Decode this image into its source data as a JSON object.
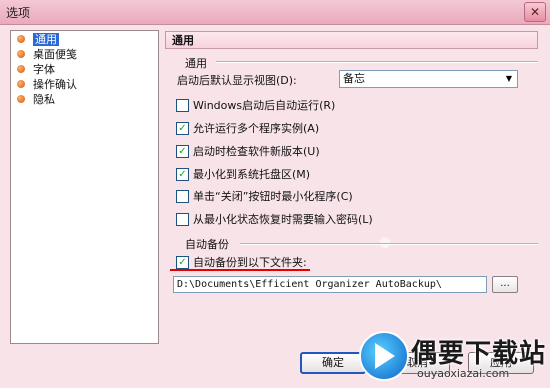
{
  "window": {
    "title": "选项",
    "close_glyph": "✕"
  },
  "tree": {
    "items": [
      {
        "label": "通用",
        "selected": true
      },
      {
        "label": "桌面便笺",
        "selected": false
      },
      {
        "label": "字体",
        "selected": false
      },
      {
        "label": "操作确认",
        "selected": false
      },
      {
        "label": "隐私",
        "selected": false
      }
    ]
  },
  "panel": {
    "header": "通用",
    "general_section": "通用",
    "startup_view_label": "启动后默认显示视图(D):",
    "startup_view_value": "备忘",
    "checkboxes": [
      {
        "label": "Windows启动后自动运行(R)",
        "checked": false
      },
      {
        "label": "允许运行多个程序实例(A)",
        "checked": true
      },
      {
        "label": "启动时检查软件新版本(U)",
        "checked": true
      },
      {
        "label": "最小化到系统托盘区(M)",
        "checked": true
      },
      {
        "label": "单击“关闭”按钮时最小化程序(C)",
        "checked": false
      },
      {
        "label": "从最小化状态恢复时需要输入密码(L)",
        "checked": false
      }
    ],
    "backup_section": "自动备份",
    "backup_checkbox": {
      "label": "自动备份到以下文件夹:",
      "checked": true
    },
    "backup_path": "D:\\Documents\\Efficient Organizer AutoBackup\\",
    "browse_label": "..."
  },
  "buttons": {
    "ok": "确定",
    "cancel": "取消",
    "apply": "应用"
  },
  "watermark": {
    "title": "偶要下载站",
    "url": "ouyaoxiazai.com"
  },
  "colors": {
    "accent": "#2b6ad6",
    "highlight_underline": "#e60000",
    "check": "#21a121"
  }
}
